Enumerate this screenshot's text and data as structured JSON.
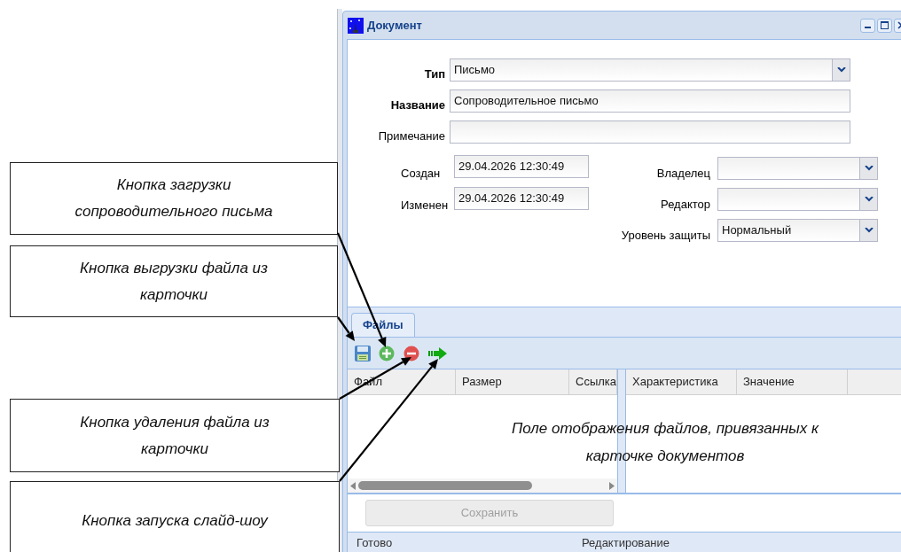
{
  "window": {
    "title": "Документ"
  },
  "form": {
    "fields": [
      {
        "label": "Тип",
        "kind": "dropdown",
        "value": "Письмо",
        "required": true
      },
      {
        "label": "Название",
        "kind": "text",
        "value": "Сопроводительное письмо",
        "required": true
      },
      {
        "label": "Примечание",
        "kind": "text",
        "required": false
      }
    ],
    "dates": [
      {
        "label": "Создан",
        "value": "29.04.2026 12:30:49"
      },
      {
        "label": "Изменен",
        "value": "29.04.2026 12:30:49"
      }
    ],
    "people": [
      {
        "label": "Владелец",
        "kind": "dropdown"
      },
      {
        "label": "Редактор",
        "kind": "dropdown"
      },
      {
        "label": "Уровень защиты",
        "kind": "dropdown",
        "value": "Нормальный"
      }
    ]
  },
  "tabs": [
    {
      "label": "Файлы",
      "selected": true
    }
  ],
  "files_grid": {
    "columns": [
      "Файл",
      "Размер",
      "Ссылка"
    ]
  },
  "properties_grid": {
    "columns": [
      "Характеристика",
      "Значение"
    ]
  },
  "save_button": {
    "label": "Сохранить",
    "disabled": true
  },
  "status_bar": [
    "Готово",
    "Редактирование"
  ],
  "callouts": [
    "Кнопка загрузки сопроводительного письма",
    "Кнопка выгрузки файла из карточки",
    "Кнопка удаления файла из карточки",
    "Кнопка запуска слайд-шоу"
  ],
  "grid_note": "Поле отображения файлов, привязанных к карточке документов"
}
